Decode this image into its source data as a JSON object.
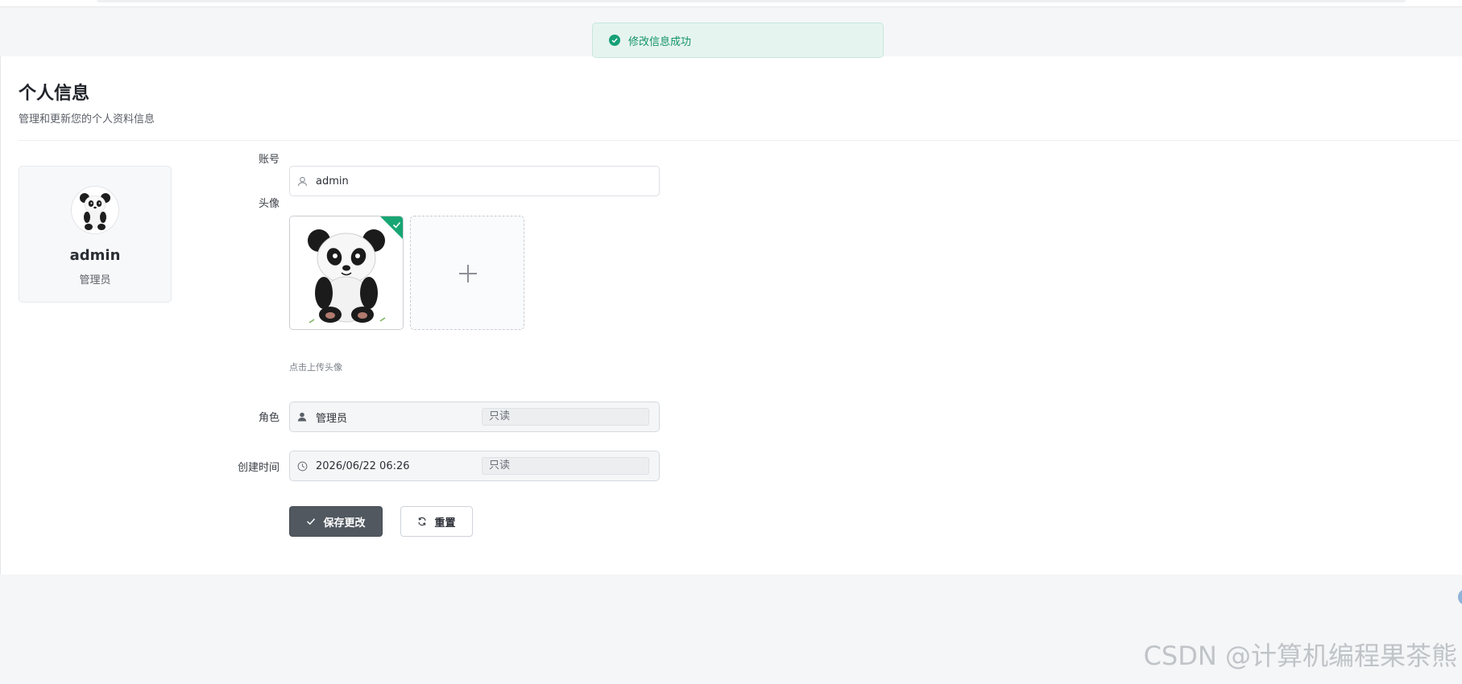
{
  "toast": {
    "message": "修改信息成功",
    "icon": "check-circle-icon",
    "color": "#16a077"
  },
  "header": {
    "title": "个人信息",
    "subtitle": "管理和更新您的个人资料信息"
  },
  "profile_card": {
    "name": "admin",
    "role": "管理员",
    "avatar_icon": "panda-avatar-icon"
  },
  "form": {
    "account": {
      "label": "账号",
      "value": "admin",
      "icon": "user-outline-icon"
    },
    "avatar": {
      "label": "头像",
      "upload_hint": "点击上传头像",
      "add_icon": "plus-icon"
    },
    "role": {
      "label": "角色",
      "value": "管理员",
      "readonly_tag": "只读",
      "icon": "user-solid-icon"
    },
    "created_time": {
      "label": "创建时间",
      "value": "2026/06/22 06:26",
      "readonly_tag": "只读",
      "icon": "clock-icon"
    }
  },
  "buttons": {
    "save": "保存更改",
    "reset": "重置"
  },
  "watermark": "CSDN @计算机编程果茶熊",
  "colors": {
    "accent": "#515860",
    "success": "#17a673"
  }
}
